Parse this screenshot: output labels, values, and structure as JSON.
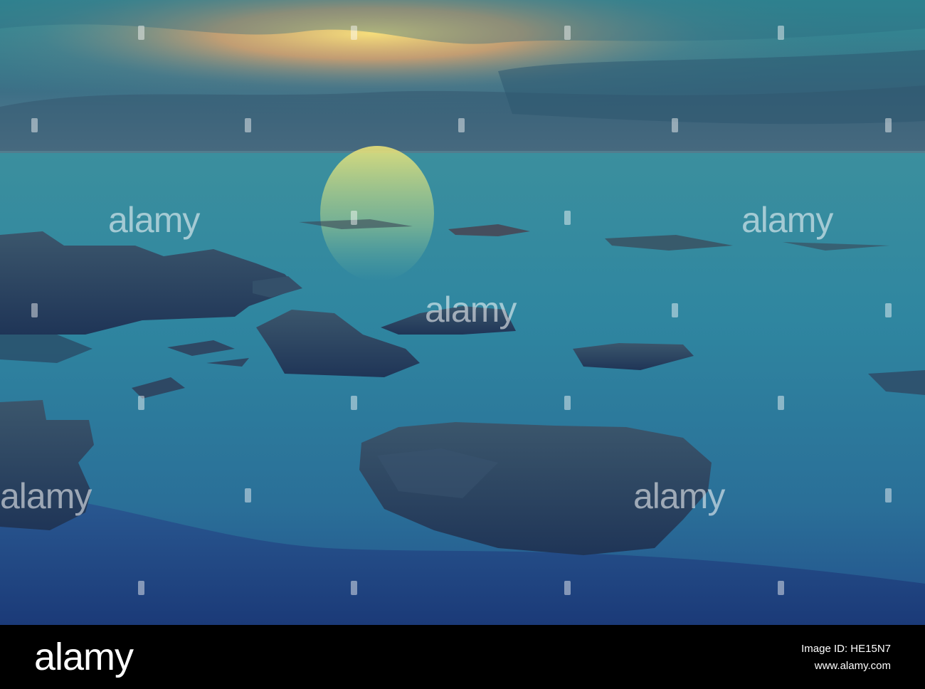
{
  "photo": {
    "scene": "seascape-sunset",
    "colors": {
      "sky_top": "#2a8a95",
      "sunglow": "#f2c45a",
      "sea": "#2f7f99",
      "rock": "#27405e",
      "sand": "#1d3f79"
    }
  },
  "watermark": {
    "text": "alamy",
    "mark_icon": "alamy-watermark-mark-icon"
  },
  "footer": {
    "logo": "alamy",
    "image_id": "Image ID: HE15N7",
    "site": "www.alamy.com"
  }
}
